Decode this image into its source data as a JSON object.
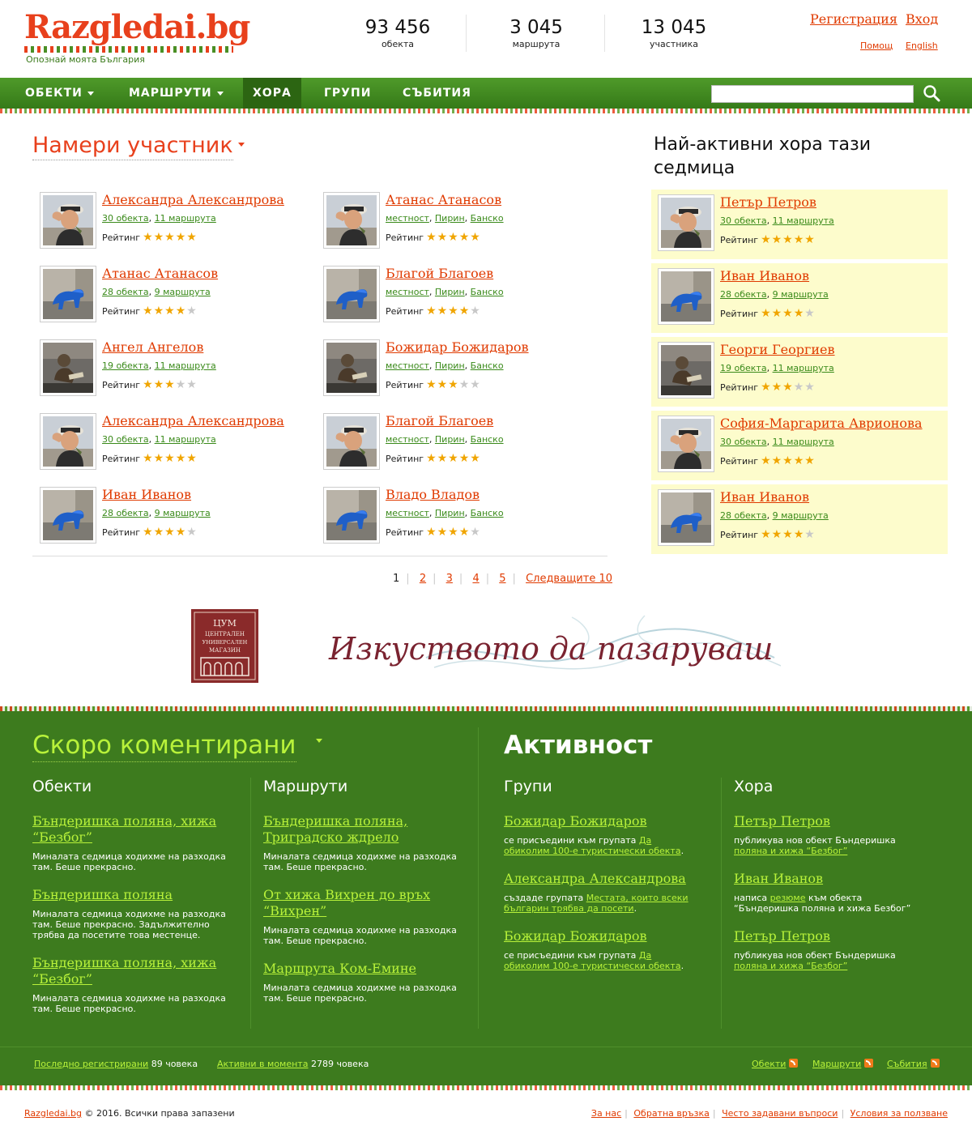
{
  "brand": {
    "name": "Razgledai.bg",
    "tagline": "Опознай моята България"
  },
  "stats": [
    {
      "value": "93 456",
      "label": "обекта"
    },
    {
      "value": "3 045",
      "label": "маршрута"
    },
    {
      "value": "13 045",
      "label": "участника"
    }
  ],
  "account": {
    "register": "Регистрация",
    "login": "Вход",
    "help": "Помощ",
    "english": "English"
  },
  "nav": {
    "items": [
      {
        "label": "ОБЕКТИ",
        "dropdown": true
      },
      {
        "label": "МАРШРУТИ",
        "dropdown": true
      },
      {
        "label": "ХОРА",
        "active": true
      },
      {
        "label": "ГРУПИ"
      },
      {
        "label": "СЪБИТИЯ"
      }
    ],
    "search_placeholder": ""
  },
  "find": {
    "title": "Намери участник",
    "rating_label": "Рейтинг",
    "left": [
      {
        "name": "Александра Александрова",
        "objects": "30 обекта",
        "routes": "11 маршрута",
        "rating": 5,
        "photo": "man"
      },
      {
        "name": "Атанас Атанасов",
        "objects": "28 обекта",
        "routes": "9 маршрута",
        "rating": 4,
        "photo": "statue"
      },
      {
        "name": "Ангел Ангелов",
        "objects": "19 обекта",
        "routes": "11 маршрута",
        "rating": 3,
        "photo": "reader"
      },
      {
        "name": "Александра Александрова",
        "objects": "30 обекта",
        "routes": "11 маршрута",
        "rating": 5,
        "photo": "man"
      },
      {
        "name": "Иван Иванов",
        "objects": "28 обекта",
        "routes": "9 маршрута",
        "rating": 4,
        "photo": "statue"
      }
    ],
    "right": [
      {
        "name": "Атанас Атанасов",
        "loc1": "местност",
        "loc2": "Пирин",
        "loc3": "Банско",
        "rating": 5,
        "photo": "man"
      },
      {
        "name": "Благой Благоев",
        "loc1": "местност",
        "loc2": "Пирин",
        "loc3": "Банско",
        "rating": 4,
        "photo": "statue"
      },
      {
        "name": "Божидар Божидаров",
        "loc1": "местност",
        "loc2": "Пирин",
        "loc3": "Банско",
        "rating": 3,
        "photo": "reader"
      },
      {
        "name": "Благой Благоев",
        "loc1": "местност",
        "loc2": "Пирин",
        "loc3": "Банско",
        "rating": 5,
        "photo": "man"
      },
      {
        "name": "Владо Владов",
        "loc1": "местност",
        "loc2": "Пирин",
        "loc3": "Банско",
        "rating": 4,
        "photo": "statue"
      }
    ],
    "pager": {
      "current": "1",
      "pages": [
        "2",
        "3",
        "4",
        "5"
      ],
      "next": "Следващите 10"
    }
  },
  "active": {
    "title": "Най-активни хора тази седмица",
    "people": [
      {
        "name": "Петър Петров",
        "objects": "30 обекта",
        "routes": "11 маршрута",
        "rating": 5,
        "photo": "man"
      },
      {
        "name": "Иван Иванов",
        "objects": "28 обекта",
        "routes": "9 маршрута",
        "rating": 4,
        "photo": "statue"
      },
      {
        "name": "Георги Георгиев",
        "objects": "19 обекта",
        "routes": "11 маршрута",
        "rating": 3,
        "photo": "reader"
      },
      {
        "name": "София-Маргарита Аврионова",
        "objects": "30 обекта",
        "routes": "11 маршрута",
        "rating": 5,
        "photo": "man"
      },
      {
        "name": "Иван Иванов",
        "objects": "28 обекта",
        "routes": "9 маршрута",
        "rating": 4,
        "photo": "statue"
      }
    ]
  },
  "banner": {
    "logo_lines": [
      "ЦУМ",
      "ЦЕНТРАЛЕН",
      "УНИВЕРСАЛЕН",
      "МАГАЗИН"
    ],
    "slogan": "Изкуството да пазаруваш"
  },
  "recent": {
    "title": "Скоро коментирани",
    "objects_heading": "Обекти",
    "routes_heading": "Маршрути",
    "objects": [
      {
        "title": "Бъндеришка поляна, хижа “Безбог”",
        "text": "Миналата седмица ходихме на разходка там. Беше прекрасно."
      },
      {
        "title": "Бъндеришка поляна",
        "text": "Миналата седмица ходихме на разходка там. Беше прекрасно. Задължително трябва да посетите това местенце."
      },
      {
        "title": "Бъндеришка поляна, хижа “Безбог”",
        "text": "Миналата седмица ходихме на разходка там. Беше прекрасно."
      }
    ],
    "routes": [
      {
        "title": "Бъндеришка поляна, Триградско ждрело",
        "text": "Миналата седмица ходихме на разходка там. Беше прекрасно."
      },
      {
        "title": "От хижа Вихрен до връх “Вихрен”",
        "text": "Миналата седмица ходихме на разходка там. Беше прекрасно."
      },
      {
        "title": "Маршрута Ком-Емине",
        "text": "Миналата седмица ходихме на разходка там. Беше прекрасно."
      }
    ]
  },
  "activity": {
    "title": "Активност",
    "groups_heading": "Групи",
    "people_heading": "Хора",
    "groups": [
      {
        "name": "Божидар Божидаров",
        "pre": "се присъедини към групата ",
        "link": "Да обиколим 100-е туристически обекта",
        "post": "."
      },
      {
        "name": "Александра Александрова",
        "pre": "създаде групата ",
        "link": "Местата, които всеки българин трябва да посети",
        "post": "."
      },
      {
        "name": "Божидар Божидаров",
        "pre": "се присъедини към групата ",
        "link": "Да обиколим 100-е туристически обекта",
        "post": "."
      }
    ],
    "people": [
      {
        "name": "Петър Петров",
        "pre": "публикува нов обект Бъндеришка ",
        "link": "поляна и хижа “Безбог”",
        "post": ""
      },
      {
        "name": "Иван Иванов",
        "pre": "написа ",
        "link": "резюме",
        "post": " към обекта “Бъндеришка поляна и хижа Безбог”"
      },
      {
        "name": "Петър Петров",
        "pre": "публикува нов обект Бъндеришка ",
        "link": "поляна и хижа “Безбог”",
        "post": ""
      }
    ]
  },
  "footer_bar": {
    "last_registered_label": "Последно регистрирани",
    "last_registered_value": "89 човека",
    "online_label": "Активни в момента",
    "online_value": "2789 човека",
    "feeds": [
      "Обекти",
      "Маршрути",
      "Събития"
    ]
  },
  "footer": {
    "site": "Razgledai.bg",
    "copyright": " © 2016. Всички права запазени",
    "links": [
      "За нас",
      "Обратна връзка",
      "Често задавани въпроси",
      "Условия за ползване"
    ]
  },
  "colors": {
    "brand_red": "#e8401c",
    "green": "#3d7b1e",
    "lime": "#b8f23a",
    "star": "#f0a500"
  }
}
